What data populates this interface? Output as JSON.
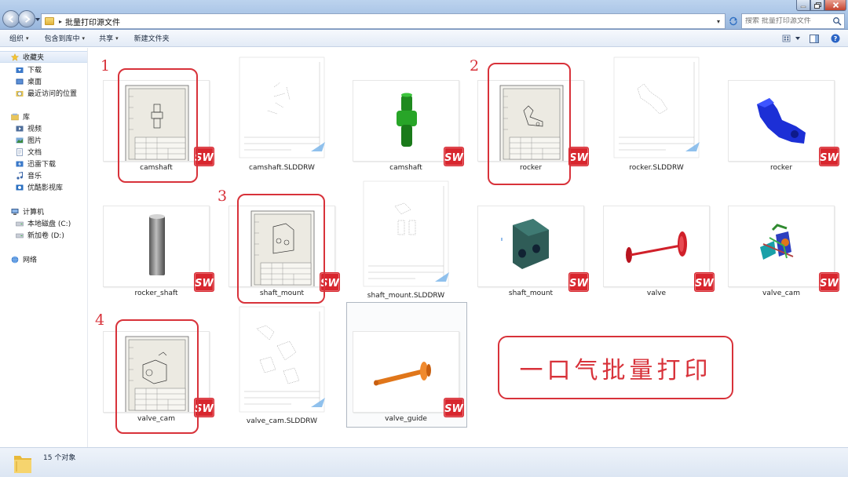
{
  "window": {
    "path_separator": "▸",
    "folder_name": "批量打印源文件",
    "search_placeholder": "搜索 批量打印源文件"
  },
  "toolbar": {
    "organize": "组织",
    "include_in_library": "包含到库中",
    "share": "共享",
    "new_folder": "新建文件夹",
    "dropdown_arrow": "▾"
  },
  "nav": {
    "favorites": "收藏夹",
    "favorites_items": [
      "下载",
      "桌面",
      "最近访问的位置"
    ],
    "libraries": "库",
    "library_items": [
      "视频",
      "图片",
      "文档",
      "迅雷下载",
      "音乐",
      "优酷影视库"
    ],
    "computer": "计算机",
    "computer_items": [
      "本地磁盘 (C:)",
      "新加卷 (D:)"
    ],
    "network": "网络"
  },
  "files": [
    {
      "name": "camshaft",
      "kind": "drawing-preview"
    },
    {
      "name": "camshaft.SLDDRW",
      "kind": "slddrw"
    },
    {
      "name": "camshaft",
      "kind": "part"
    },
    {
      "name": "rocker",
      "kind": "drawing-preview"
    },
    {
      "name": "rocker.SLDDRW",
      "kind": "slddrw"
    },
    {
      "name": "rocker",
      "kind": "part"
    },
    {
      "name": "rocker_shaft",
      "kind": "part"
    },
    {
      "name": "shaft_mount",
      "kind": "drawing-preview"
    },
    {
      "name": "shaft_mount.SLDDRW",
      "kind": "slddrw"
    },
    {
      "name": "shaft_mount",
      "kind": "part"
    },
    {
      "name": "valve",
      "kind": "part"
    },
    {
      "name": "valve_cam",
      "kind": "assembly"
    },
    {
      "name": "valve_cam",
      "kind": "drawing-preview"
    },
    {
      "name": "valve_cam.SLDDRW",
      "kind": "slddrw"
    },
    {
      "name": "valve_guide",
      "kind": "part"
    }
  ],
  "annotations": {
    "numbers": [
      "1",
      "2",
      "3",
      "4"
    ],
    "callout": "一口气批量打印",
    "annotation_color": "#d8323a"
  },
  "sw_badge": "SW",
  "status": {
    "count": "15 个对象"
  },
  "colors": {
    "accent": "#d8323a",
    "camshaft_part": "#1f8a1f",
    "rocker_part": "#1c2fd6",
    "shaft_mount_part": "#2f5c57",
    "valve_part": "#d0202a",
    "valve_guide_part": "#e0761a"
  }
}
